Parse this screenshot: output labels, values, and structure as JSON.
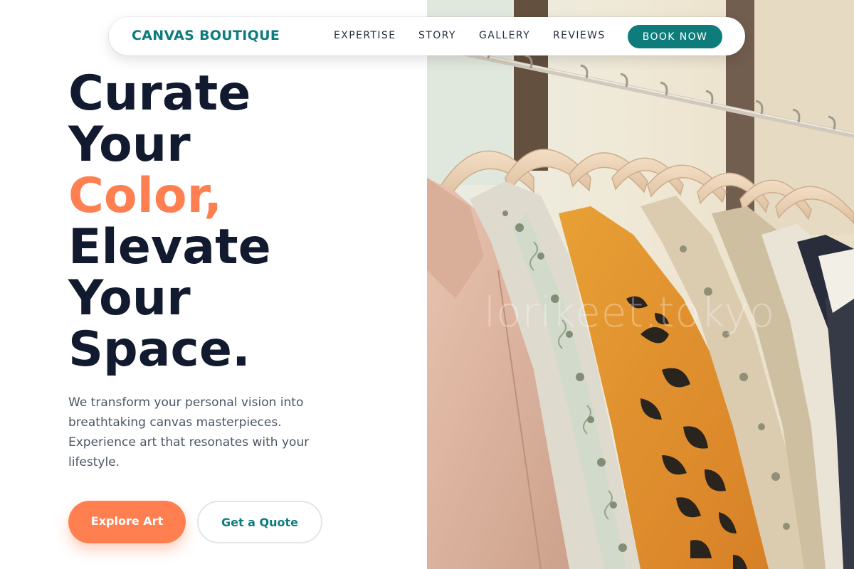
{
  "nav": {
    "brand": "CANVAS BOUTIQUE",
    "links": [
      "EXPERTISE",
      "STORY",
      "GALLERY",
      "REVIEWS"
    ],
    "cta": "BOOK NOW"
  },
  "hero": {
    "headline": {
      "line1": "Curate",
      "line2": "Your",
      "line3": "Color,",
      "line4": "Elevate",
      "line5": "Your",
      "line6": "Space."
    },
    "description": "We transform your personal vision into breathtaking canvas masterpieces. Experience art that resonates with your lifestyle.",
    "primary_button": "Explore Art",
    "secondary_button": "Get a Quote",
    "image": {
      "subject": "clothing-rack-photo",
      "watermark": "lorikeet.tokyo"
    }
  },
  "colors": {
    "brand_teal": "#0f7c7c",
    "accent_coral": "#ff7f50",
    "heading_navy": "#111a2e",
    "body_gray": "#4b5566"
  }
}
